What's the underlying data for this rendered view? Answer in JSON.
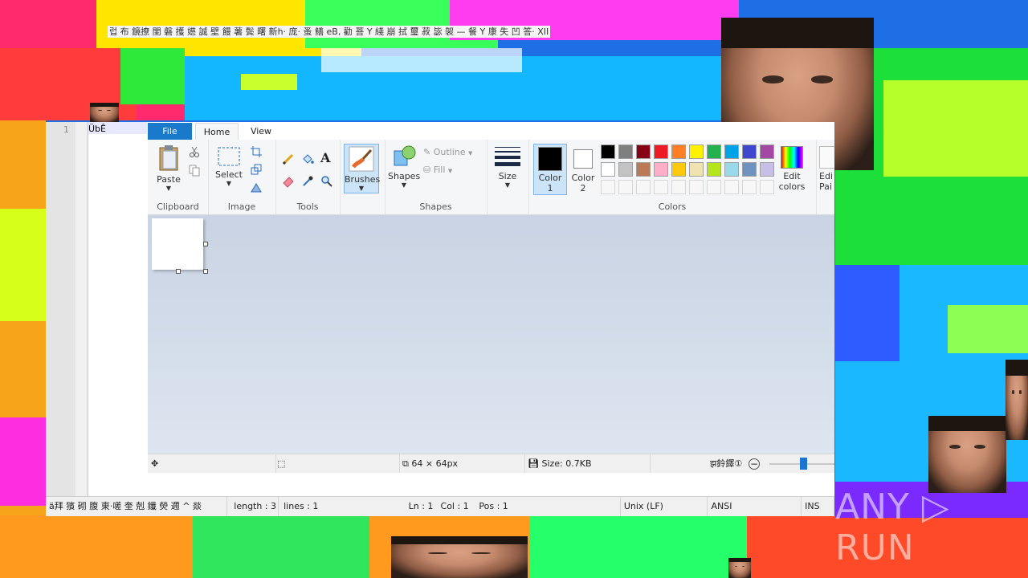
{
  "background_title_garbled": "럽 布 鏡撩 閨 磐 擭 嬨 誠 壁 饅 薯 鬓 曙 新h· 庞· 蚤 鳝 eB, 勸 菩 Y 綫 崩 拭 璽 菽 毖 袈 — 餐 Y 康 失 凹 答· XII",
  "editor": {
    "line_number": "1",
    "line_text": "ÜbÊ",
    "status": {
      "doc_type": "ä拜 獱 砌 腹 東·嗟 奎 剋 鑯 熒 邇 ^ 燚",
      "length": "length : 3",
      "lines": "lines : 1",
      "ln": "Ln : 1",
      "col": "Col : 1",
      "pos": "Pos : 1",
      "eol": "Unix (LF)",
      "encoding": "ANSI",
      "mode": "INS"
    }
  },
  "paint": {
    "tabs": {
      "file": "File",
      "home": "Home",
      "view": "View"
    },
    "clipboard": {
      "paste": "Paste",
      "group": "Clipboard"
    },
    "image": {
      "select": "Select",
      "group": "Image"
    },
    "tools": {
      "group": "Tools"
    },
    "brushes": {
      "label": "Brushes"
    },
    "shapes": {
      "shapes": "Shapes",
      "outline": "Outline",
      "fill": "Fill",
      "group": "Shapes"
    },
    "size": {
      "label": "Size"
    },
    "colors": {
      "color1": "Color",
      "color1_num": "1",
      "color2": "Color",
      "color2_num": "2",
      "edit": "Edit",
      "edit2": "colors",
      "edit_paint3d": "Edi",
      "edit_paint3d2": "Pai",
      "group": "Colors",
      "color1_value": "#000000",
      "color2_value": "#ffffff",
      "palette_row1": [
        "#000000",
        "#7f7f7f",
        "#880015",
        "#ed1c24",
        "#ff7f27",
        "#fff200",
        "#22b14c",
        "#00a2e8",
        "#3f48cc",
        "#a349a4"
      ],
      "palette_row2": [
        "#ffffff",
        "#c3c3c3",
        "#b97a57",
        "#ffaec9",
        "#ffc90e",
        "#efe4b0",
        "#b5e61d",
        "#99d9ea",
        "#7092be",
        "#c8bfe7"
      ]
    },
    "status": {
      "dimensions": "64 × 64px",
      "size": "Size: 0.7KB",
      "zoom_label": "झ鈴鐸①"
    }
  },
  "watermark": "ANY ▷ RUN"
}
